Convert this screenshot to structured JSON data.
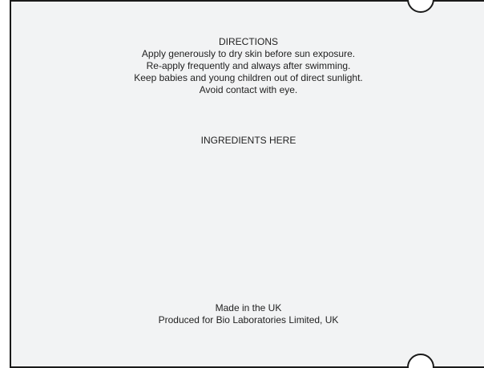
{
  "directions": {
    "heading": "DIRECTIONS",
    "lines": [
      "Apply generously to dry skin before sun exposure.",
      "Re-apply frequently and always after swimming.",
      "Keep babies and young children out of direct sunlight.",
      "Avoid contact with eye."
    ]
  },
  "ingredients": {
    "placeholder": "INGREDIENTS HERE"
  },
  "origin": {
    "made_in": "Made in the UK",
    "produced_for": "Produced for Bio Laboratories Limited, UK"
  },
  "colors": {
    "panel_background": "#f2f3f4",
    "outline": "#1a1a1a",
    "text": "#1f1f1f"
  }
}
